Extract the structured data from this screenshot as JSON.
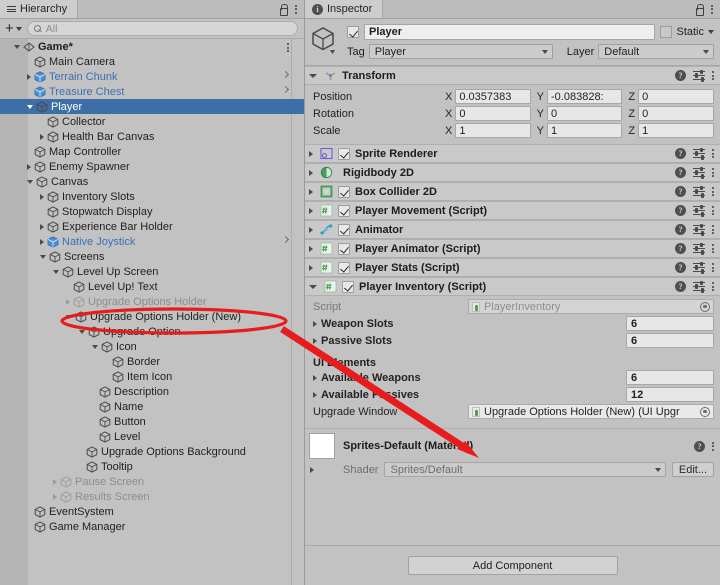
{
  "hierarchy": {
    "tab_label": "Hierarchy",
    "toolbar": {
      "add_label": "+",
      "search_placeholder": "All"
    },
    "rows": [
      {
        "label": "Game*",
        "depth": 0,
        "tw": "open",
        "icon": "scene-icon",
        "style": "root",
        "chev": false,
        "kebab": true
      },
      {
        "label": "Main Camera",
        "depth": 1,
        "tw": "none",
        "icon": "cube-icon",
        "style": "normal",
        "chev": false
      },
      {
        "label": "Terrain Chunk",
        "depth": 1,
        "tw": "closed",
        "icon": "prefab-icon",
        "style": "prefab",
        "chev": true
      },
      {
        "label": "Treasure Chest",
        "depth": 1,
        "tw": "none",
        "icon": "prefab-icon",
        "style": "prefab",
        "chev": true
      },
      {
        "label": "Player",
        "depth": 1,
        "tw": "open",
        "icon": "cube-icon",
        "style": "selected",
        "chev": false
      },
      {
        "label": "Collector",
        "depth": 2,
        "tw": "none",
        "icon": "cube-icon",
        "style": "normal",
        "chev": false
      },
      {
        "label": "Health Bar Canvas",
        "depth": 2,
        "tw": "closed",
        "icon": "cube-icon",
        "style": "normal",
        "chev": false
      },
      {
        "label": "Map Controller",
        "depth": 1,
        "tw": "none",
        "icon": "cube-icon",
        "style": "normal",
        "chev": false
      },
      {
        "label": "Enemy Spawner",
        "depth": 1,
        "tw": "closed",
        "icon": "cube-icon",
        "style": "normal",
        "chev": false
      },
      {
        "label": "Canvas",
        "depth": 1,
        "tw": "open",
        "icon": "cube-icon",
        "style": "normal",
        "chev": false
      },
      {
        "label": "Inventory Slots",
        "depth": 2,
        "tw": "closed",
        "icon": "cube-icon",
        "style": "normal",
        "chev": false
      },
      {
        "label": "Stopwatch Display",
        "depth": 2,
        "tw": "none",
        "icon": "cube-icon",
        "style": "normal",
        "chev": false
      },
      {
        "label": "Experience Bar Holder",
        "depth": 2,
        "tw": "closed",
        "icon": "cube-icon",
        "style": "normal",
        "chev": false
      },
      {
        "label": "Native Joystick",
        "depth": 2,
        "tw": "closed",
        "icon": "prefab-icon",
        "style": "prefab",
        "chev": true
      },
      {
        "label": "Screens",
        "depth": 2,
        "tw": "open",
        "icon": "cube-icon",
        "style": "normal",
        "chev": false
      },
      {
        "label": "Level Up Screen",
        "depth": 3,
        "tw": "open",
        "icon": "cube-icon",
        "style": "normal",
        "chev": false
      },
      {
        "label": "Level Up! Text",
        "depth": 4,
        "tw": "none",
        "icon": "cube-icon",
        "style": "normal",
        "chev": false
      },
      {
        "label": "Upgrade Options Holder",
        "depth": 4,
        "tw": "closed",
        "icon": "cube-icon",
        "style": "dim",
        "chev": false
      },
      {
        "label": "Upgrade Options Holder (New)",
        "depth": 4,
        "tw": "open",
        "icon": "cube-icon",
        "style": "normal",
        "chev": false
      },
      {
        "label": "Upgrade Option",
        "depth": 5,
        "tw": "open",
        "icon": "cube-icon",
        "style": "normal",
        "chev": false
      },
      {
        "label": "Icon",
        "depth": 6,
        "tw": "open",
        "icon": "cube-icon",
        "style": "normal",
        "chev": false
      },
      {
        "label": "Border",
        "depth": 7,
        "tw": "none",
        "icon": "cube-icon",
        "style": "normal",
        "chev": false
      },
      {
        "label": "Item Icon",
        "depth": 7,
        "tw": "none",
        "icon": "cube-icon",
        "style": "normal",
        "chev": false
      },
      {
        "label": "Description",
        "depth": 6,
        "tw": "none",
        "icon": "cube-icon",
        "style": "normal",
        "chev": false
      },
      {
        "label": "Name",
        "depth": 6,
        "tw": "none",
        "icon": "cube-icon",
        "style": "normal",
        "chev": false
      },
      {
        "label": "Button",
        "depth": 6,
        "tw": "none",
        "icon": "cube-icon",
        "style": "normal",
        "chev": false
      },
      {
        "label": "Level",
        "depth": 6,
        "tw": "none",
        "icon": "cube-icon",
        "style": "normal",
        "chev": false
      },
      {
        "label": "Upgrade Options Background",
        "depth": 5,
        "tw": "none",
        "icon": "cube-icon",
        "style": "normal",
        "chev": false
      },
      {
        "label": "Tooltip",
        "depth": 5,
        "tw": "none",
        "icon": "cube-icon",
        "style": "normal",
        "chev": false
      },
      {
        "label": "Pause Screen",
        "depth": 3,
        "tw": "closed",
        "icon": "cube-icon",
        "style": "dim",
        "chev": false
      },
      {
        "label": "Results Screen",
        "depth": 3,
        "tw": "closed",
        "icon": "cube-icon",
        "style": "dim",
        "chev": false
      },
      {
        "label": "EventSystem",
        "depth": 1,
        "tw": "none",
        "icon": "cube-icon",
        "style": "normal",
        "chev": false
      },
      {
        "label": "Game Manager",
        "depth": 1,
        "tw": "none",
        "icon": "cube-icon",
        "style": "normal",
        "chev": false
      }
    ]
  },
  "inspector": {
    "tab_label": "Inspector",
    "object": {
      "name": "Player",
      "enabled": true,
      "static_label": "Static",
      "static_checked": false,
      "tag_label": "Tag",
      "tag_value": "Player",
      "layer_label": "Layer",
      "layer_value": "Default"
    },
    "transform": {
      "title": "Transform",
      "rows": [
        {
          "name": "Position",
          "x": "0.0357383",
          "y": "-0.083828:",
          "z": "0"
        },
        {
          "name": "Rotation",
          "x": "0",
          "y": "0",
          "z": "0"
        },
        {
          "name": "Scale",
          "x": "1",
          "y": "1",
          "z": "1"
        }
      ]
    },
    "components": [
      {
        "title": "Sprite Renderer",
        "icon": "sprite-renderer-icon",
        "expanded": false,
        "has_checkbox": true,
        "checked": true
      },
      {
        "title": "Rigidbody 2D",
        "icon": "rigidbody2d-icon",
        "expanded": false,
        "has_checkbox": false,
        "checked": false
      },
      {
        "title": "Box Collider 2D",
        "icon": "boxcollider2d-icon",
        "expanded": false,
        "has_checkbox": true,
        "checked": true
      },
      {
        "title": "Player Movement (Script)",
        "icon": "script-icon",
        "expanded": false,
        "has_checkbox": true,
        "checked": true
      },
      {
        "title": "Animator",
        "icon": "animator-icon",
        "expanded": false,
        "has_checkbox": true,
        "checked": true
      },
      {
        "title": "Player Animator (Script)",
        "icon": "script-icon",
        "expanded": false,
        "has_checkbox": true,
        "checked": true
      },
      {
        "title": "Player Stats (Script)",
        "icon": "script-icon",
        "expanded": false,
        "has_checkbox": true,
        "checked": true
      },
      {
        "title": "Player Inventory (Script)",
        "icon": "script-icon",
        "expanded": true,
        "has_checkbox": true,
        "checked": true
      }
    ],
    "player_inventory": {
      "script_label": "Script",
      "script_value": "PlayerInventory",
      "weapon_slots_label": "Weapon Slots",
      "weapon_slots_value": "6",
      "passive_slots_label": "Passive Slots",
      "passive_slots_value": "6",
      "ui_elements_header": "UI Elements",
      "available_weapons_label": "Available Weapons",
      "available_weapons_value": "6",
      "available_passives_label": "Available Passives",
      "available_passives_value": "12",
      "upgrade_window_label": "Upgrade Window",
      "upgrade_window_value": "Upgrade Options Holder (New) (UI Upgr"
    },
    "material": {
      "title": "Sprites-Default (Material)",
      "shader_label": "Shader",
      "shader_value": "Sprites/Default",
      "edit_label": "Edit..."
    },
    "footer": {
      "add_component_label": "Add Component"
    }
  },
  "annotation": {
    "color": "#e81c1c",
    "highlight_target": "Upgrade Options Holder (New)",
    "arrow_from": "hierarchy-row-upgrade-options-holder-new",
    "arrow_to": "upgrade-window-field"
  }
}
